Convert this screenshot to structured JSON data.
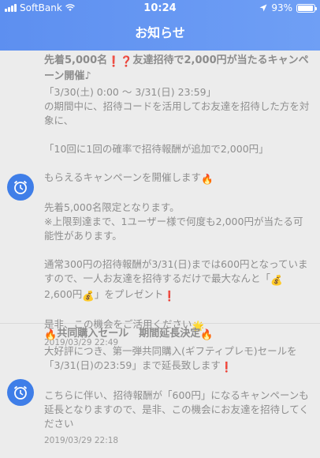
{
  "status": {
    "carrier": "SoftBank",
    "time": "10:24",
    "battery": "93%",
    "battery_level": 0.93
  },
  "header": {
    "title": "お知らせ"
  },
  "notices": [
    {
      "title_a": "先着5,000名",
      "title_b": "友達招待で2,000円が当たるキャンペーン開催♪",
      "body": [
        "「3/30(土) 0:00 〜 3/31(日) 23:59」",
        "の期間中に、招待コードを活用してお友達を招待した方を対象に、",
        "",
        "「10回に1回の確率で招待報酬が追加で2,000円」",
        "",
        "もらえるキャンペーンを開催します"
      ],
      "body2": [
        "先着5,000名限定となります。",
        "※上限到達まで、1ユーザー様で何度も2,000円が当たる可能性があります。",
        "",
        "通常300円の招待報酬が3/31(日)までは600円となっていますので、一人お友達を招待するだけで最大なんと「"
      ],
      "body2_tail": "2,600円",
      "body2_end": "」をプレゼント",
      "body3": "是非、この機会をご活用ください",
      "date": "2019/03/29 22:49"
    },
    {
      "title": "共同購入セール　期間延長決定",
      "body": "大好評につき、第一弾共同購入(ギフティプレモ)セールを「3/31(日)の23:59」まで延長致します",
      "body2": "こちらに伴い、招待報酬が「600円」になるキャンペーンも延長となりますので、是非、この機会にお友達を招待してください",
      "date": "2019/03/29 22:18"
    }
  ],
  "icons": [
    "signal-icon",
    "wifi-icon",
    "location-icon",
    "battery-icon",
    "bell-clock-icon",
    "fire-icon",
    "money-bag-icon",
    "sparkle-icon"
  ]
}
